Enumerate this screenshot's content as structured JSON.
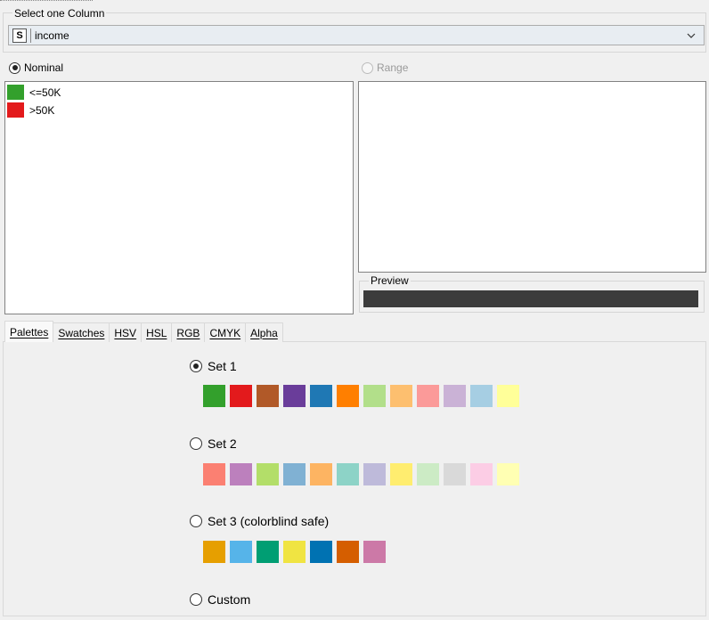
{
  "column_select": {
    "group_title": "Select one Column",
    "type_badge": "S",
    "selected_value": "income",
    "dropdown_icon": "chevron-down-icon"
  },
  "nominal": {
    "label": "Nominal",
    "selected": true,
    "items": [
      {
        "label": "<=50K",
        "color": "#33a02c"
      },
      {
        "label": ">50K",
        "color": "#e31a1c"
      }
    ]
  },
  "range": {
    "label": "Range",
    "enabled": false
  },
  "preview": {
    "title": "Preview",
    "color": "#3c3c3c"
  },
  "tabs": [
    {
      "label": "Palettes",
      "active": true
    },
    {
      "label": "Swatches",
      "active": false
    },
    {
      "label": "HSV",
      "active": false
    },
    {
      "label": "HSL",
      "active": false
    },
    {
      "label": "RGB",
      "active": false
    },
    {
      "label": "CMYK",
      "active": false
    },
    {
      "label": "Alpha",
      "active": false
    }
  ],
  "palettes": {
    "set1": {
      "label": "Set 1",
      "selected": true,
      "colors": [
        "#33a02c",
        "#e31a1c",
        "#b15928",
        "#6a3d9a",
        "#1f78b4",
        "#ff7f00",
        "#b2df8a",
        "#fdbf6f",
        "#fb9a99",
        "#cab2d6",
        "#a6cee3",
        "#ffff99"
      ]
    },
    "set2": {
      "label": "Set 2",
      "selected": false,
      "colors": [
        "#fb8072",
        "#bc80bd",
        "#b3de69",
        "#80b1d3",
        "#fdb462",
        "#8dd3c7",
        "#bebada",
        "#ffed6f",
        "#ccebc5",
        "#d9d9d9",
        "#fccde5",
        "#ffffb3"
      ]
    },
    "set3": {
      "label": "Set 3 (colorblind safe)",
      "selected": false,
      "colors": [
        "#e69f00",
        "#56b4e9",
        "#009e73",
        "#f0e442",
        "#0072b2",
        "#d55e00",
        "#cc79a7"
      ]
    },
    "custom": {
      "label": "Custom",
      "selected": false
    }
  }
}
